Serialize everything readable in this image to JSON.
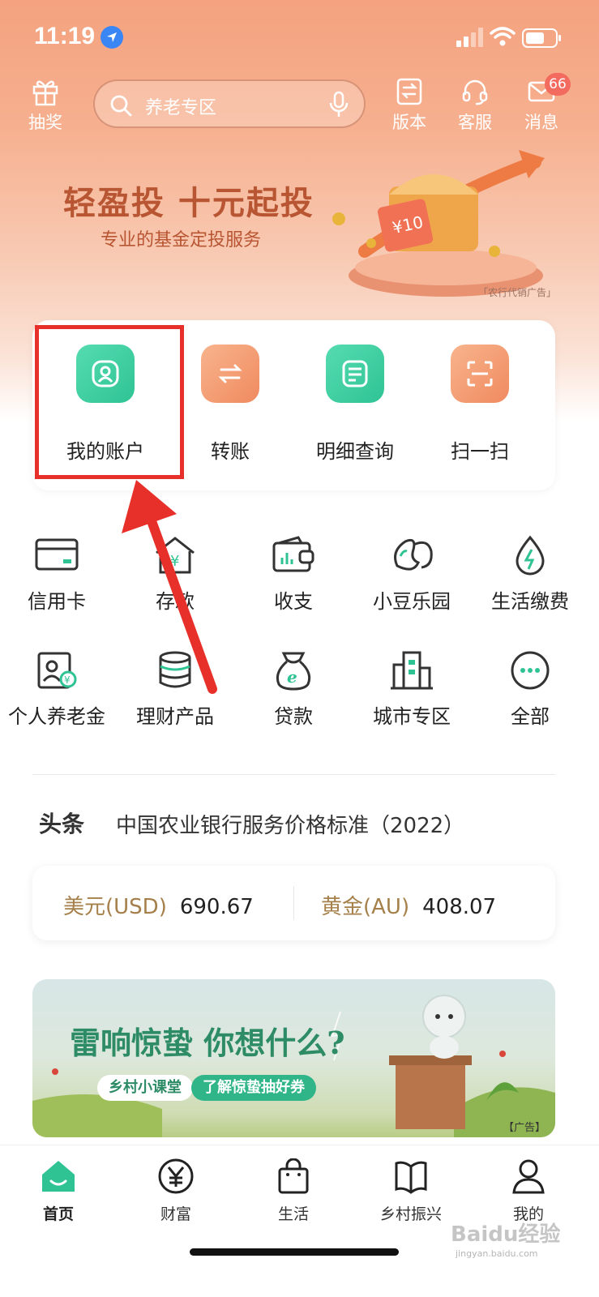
{
  "status_bar": {
    "time": "11:19"
  },
  "top_nav": {
    "lottery_label": "抽奖",
    "search_placeholder": "养老专区",
    "version_label": "版本",
    "service_label": "客服",
    "messages_label": "消息",
    "messages_badge": "66"
  },
  "banner": {
    "title": "轻盈投  十元起投",
    "subtitle": "专业的基金定投服务",
    "ad_note": "「农行代销广告」",
    "coupon_text": "¥10"
  },
  "quick_actions": [
    {
      "label": "我的账户",
      "icon": "user-icon"
    },
    {
      "label": "转账",
      "icon": "transfer-icon"
    },
    {
      "label": "明细查询",
      "icon": "document-icon"
    },
    {
      "label": "扫一扫",
      "icon": "scan-icon"
    }
  ],
  "services": [
    {
      "label": "信用卡",
      "icon": "credit-card-icon"
    },
    {
      "label": "存款",
      "icon": "deposit-house-icon"
    },
    {
      "label": "收支",
      "icon": "wallet-icon"
    },
    {
      "label": "小豆乐园",
      "icon": "bean-icon"
    },
    {
      "label": "生活缴费",
      "icon": "utility-drop-icon"
    },
    {
      "label": "个人养老金",
      "icon": "pension-icon"
    },
    {
      "label": "理财产品",
      "icon": "coins-stack-icon"
    },
    {
      "label": "贷款",
      "icon": "money-bag-icon"
    },
    {
      "label": "城市专区",
      "icon": "city-buildings-icon"
    },
    {
      "label": "全部",
      "icon": "more-icon"
    }
  ],
  "headline": {
    "tag": "头条",
    "text": "中国农业银行服务价格标准（2022）"
  },
  "rates": {
    "usd_name": "美元(USD)",
    "usd_value": "690.67",
    "gold_name": "黄金(AU)",
    "gold_value": "408.07"
  },
  "promo": {
    "title": "雷响惊蛰 你想什么?",
    "pill1": "乡村小课堂",
    "pill2": "了解惊蛰抽好券",
    "ad_note": "【广告】"
  },
  "tabs": [
    {
      "label": "首页",
      "icon": "home-icon"
    },
    {
      "label": "财富",
      "icon": "yen-icon"
    },
    {
      "label": "生活",
      "icon": "shopping-bag-icon"
    },
    {
      "label": "乡村振兴",
      "icon": "book-icon"
    },
    {
      "label": "我的",
      "icon": "profile-icon"
    }
  ],
  "watermark": {
    "main": "Baidu经验",
    "sub": "jingyan.baidu.com"
  },
  "colors": {
    "brand_green": "#2fc394",
    "accent_orange": "#f08a5f",
    "highlight_red": "#e8302a"
  }
}
